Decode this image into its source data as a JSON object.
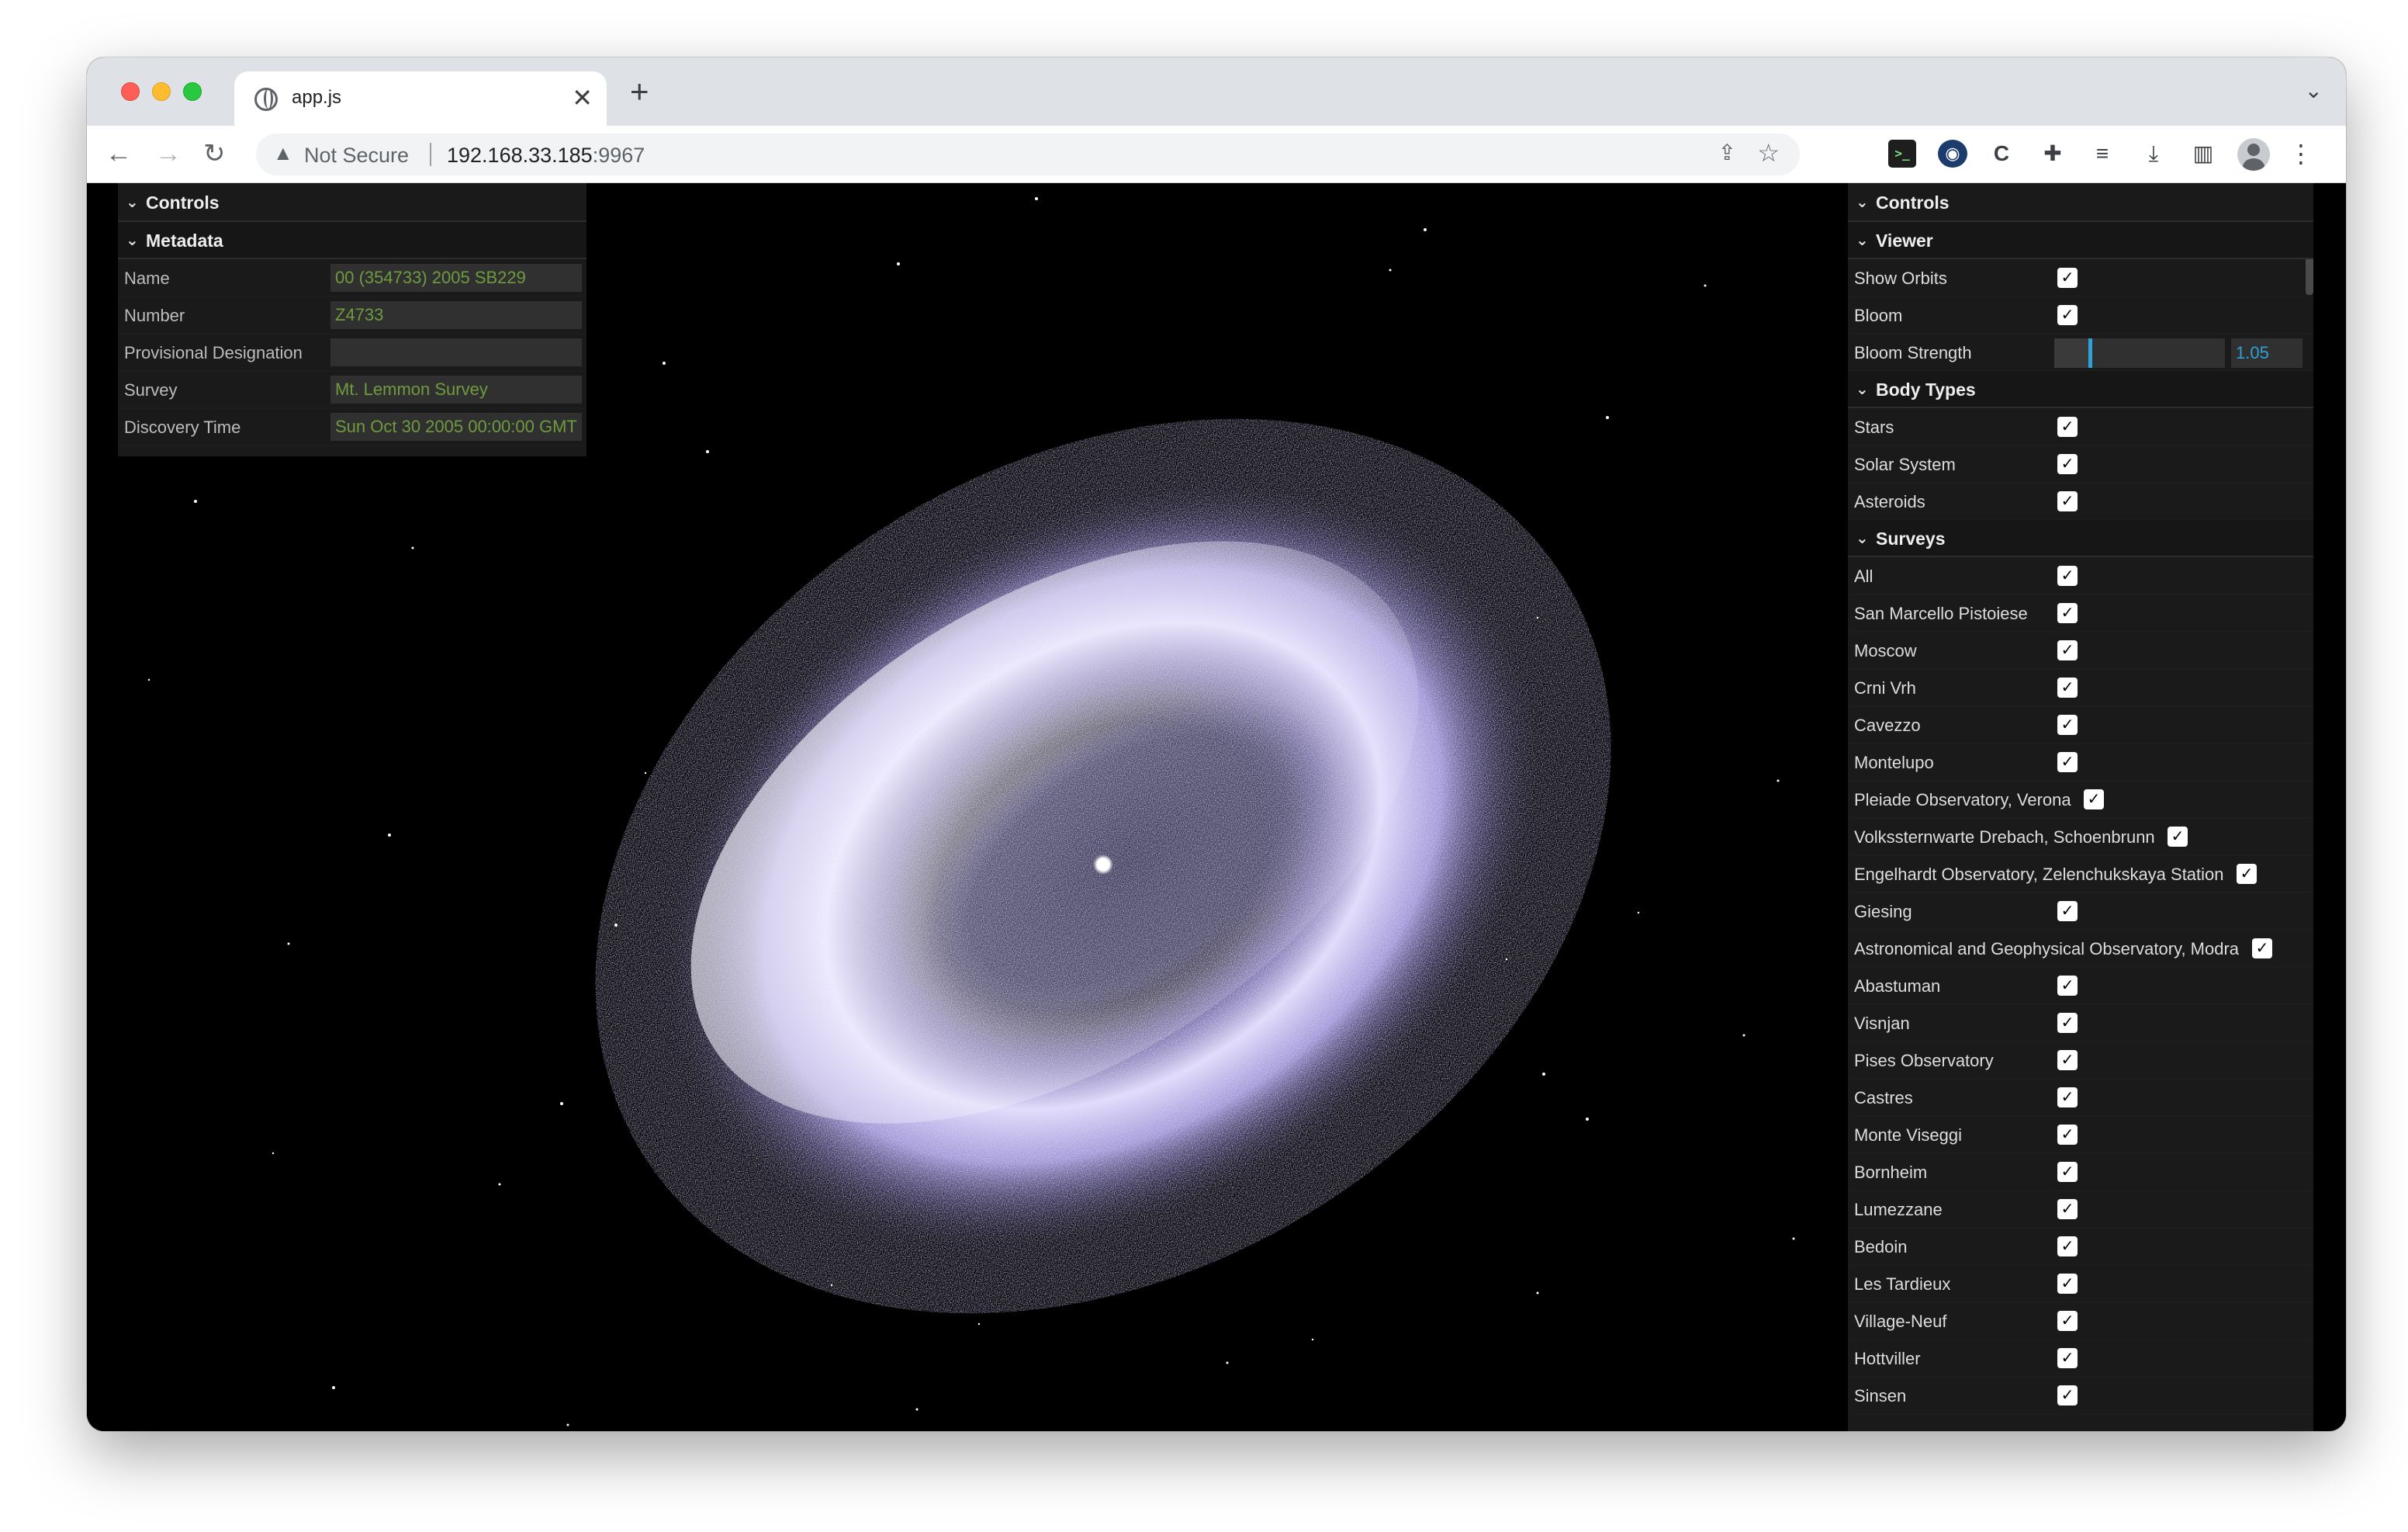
{
  "browser": {
    "tab_title": "app.js",
    "security_label": "Not Secure",
    "url_host": "192.168.33.185",
    "url_port": ":9967"
  },
  "left_panel": {
    "title": "Controls",
    "metadata_title": "Metadata",
    "fields": [
      {
        "label": "Name",
        "value": "00 (354733) 2005 SB229"
      },
      {
        "label": "Number",
        "value": "Z4733"
      },
      {
        "label": "Provisional Designation",
        "value": ""
      },
      {
        "label": "Survey",
        "value": "Mt. Lemmon Survey"
      },
      {
        "label": "Discovery Time",
        "value": "Sun Oct 30 2005 00:00:00 GMT"
      }
    ]
  },
  "right_panel": {
    "title": "Controls",
    "viewer": {
      "title": "Viewer",
      "show_orbits": "Show Orbits",
      "bloom": "Bloom",
      "bloom_strength_label": "Bloom Strength",
      "bloom_strength_value": "1.05",
      "bloom_strength_fraction": 0.21
    },
    "body_types": {
      "title": "Body Types",
      "items": [
        "Stars",
        "Solar System",
        "Asteroids"
      ]
    },
    "surveys": {
      "title": "Surveys",
      "items": [
        "All",
        "San Marcello Pistoiese",
        "Moscow",
        "Crni Vrh",
        "Cavezzo",
        "Montelupo",
        "Pleiade Observatory, Verona",
        "Volkssternwarte Drebach, Schoenbrunn",
        "Engelhardt Observatory, Zelenchukskaya Station",
        "Giesing",
        "Astronomical and Geophysical Observatory, Modra",
        "Abastuman",
        "Visnjan",
        "Pises Observatory",
        "Castres",
        "Monte Viseggi",
        "Bornheim",
        "Lumezzane",
        "Bedoin",
        "Les Tardieux",
        "Village-Neuf",
        "Hottviller",
        "Sinsen"
      ]
    }
  },
  "colors": {
    "accent": "#2fa1d6",
    "field_text": "#6e9b3d",
    "ring": "#b3a6ff"
  }
}
